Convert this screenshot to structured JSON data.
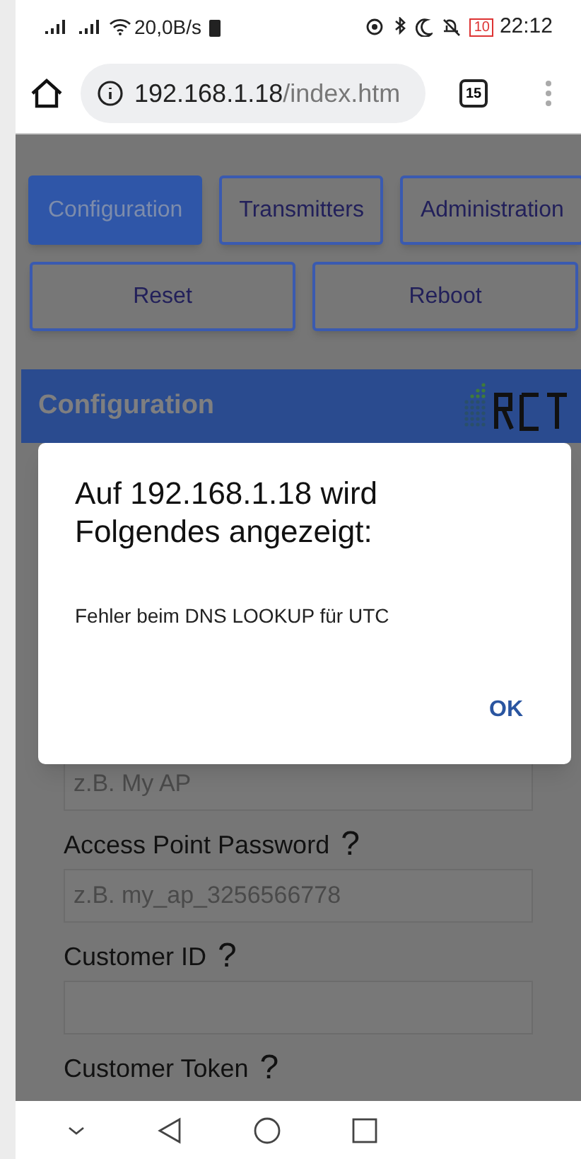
{
  "status_bar": {
    "speed": "20,0B/s",
    "battery": "10",
    "time": "22:12"
  },
  "browser": {
    "host": "192.168.1.18",
    "path": "/index.htm",
    "tab_count": "15"
  },
  "nav_buttons": [
    {
      "label": "Configuration",
      "selected": true
    },
    {
      "label": "Transmitters",
      "selected": false
    },
    {
      "label": "Administration",
      "selected": false
    }
  ],
  "action_buttons": [
    "Reset",
    "Reboot"
  ],
  "section": {
    "title": "Configuration"
  },
  "fields": [
    {
      "placeholder": "z.B. My AP"
    },
    {
      "label": "Access Point Password",
      "help": "?",
      "placeholder": "z.B. my_ap_3256566778"
    },
    {
      "label": "Customer ID",
      "help": "?"
    },
    {
      "label": "Customer Token",
      "help": "?"
    }
  ],
  "dialog": {
    "title": "Auf 192.168.1.18 wird Folgendes angezeigt:",
    "message": "Fehler beim DNS LOOKUP für UTC",
    "button": "OK"
  }
}
